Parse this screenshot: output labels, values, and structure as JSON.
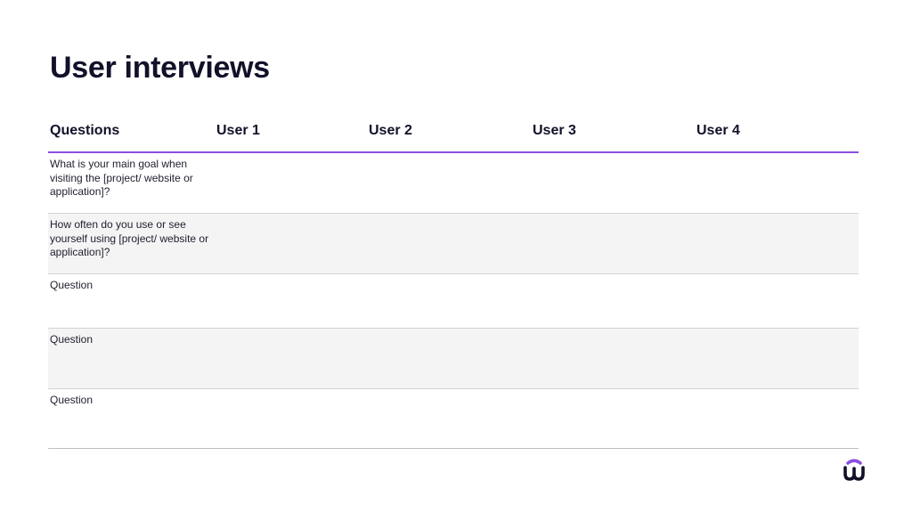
{
  "title": "User interviews",
  "table": {
    "headers": [
      "Questions",
      "User 1",
      "User 2",
      "User 3",
      "User 4"
    ],
    "rows": [
      {
        "question": "What is your main goal when visiting the [project/ website or application]?"
      },
      {
        "question": "How often do you use or see yourself using [project/ website or application]?"
      },
      {
        "question": "Question"
      },
      {
        "question": "Question"
      },
      {
        "question": "Question"
      }
    ]
  },
  "colors": {
    "accent": "#8a4fe0",
    "text": "#11112a",
    "row_shade": "#f4f4f4",
    "divider": "#d4d4d4"
  },
  "logo": {
    "icon": "brand-logo-icon"
  }
}
